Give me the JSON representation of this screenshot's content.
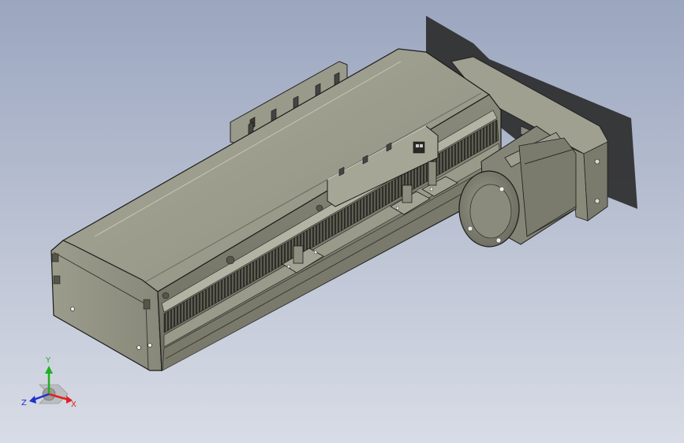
{
  "viewport": {
    "background_top": "#9ba6bf",
    "background_bottom": "#d8dce6"
  },
  "model": {
    "body_color": "#8d8d7d",
    "body_top_color": "#a3a393",
    "shadow_color": "#2a2a2a",
    "motor_color": "#7d7e6f"
  },
  "triad": {
    "x_label": "X",
    "y_label": "Y",
    "z_label": "Z",
    "x_color": "#e02020",
    "y_color": "#20b020",
    "z_color": "#2030d0"
  }
}
